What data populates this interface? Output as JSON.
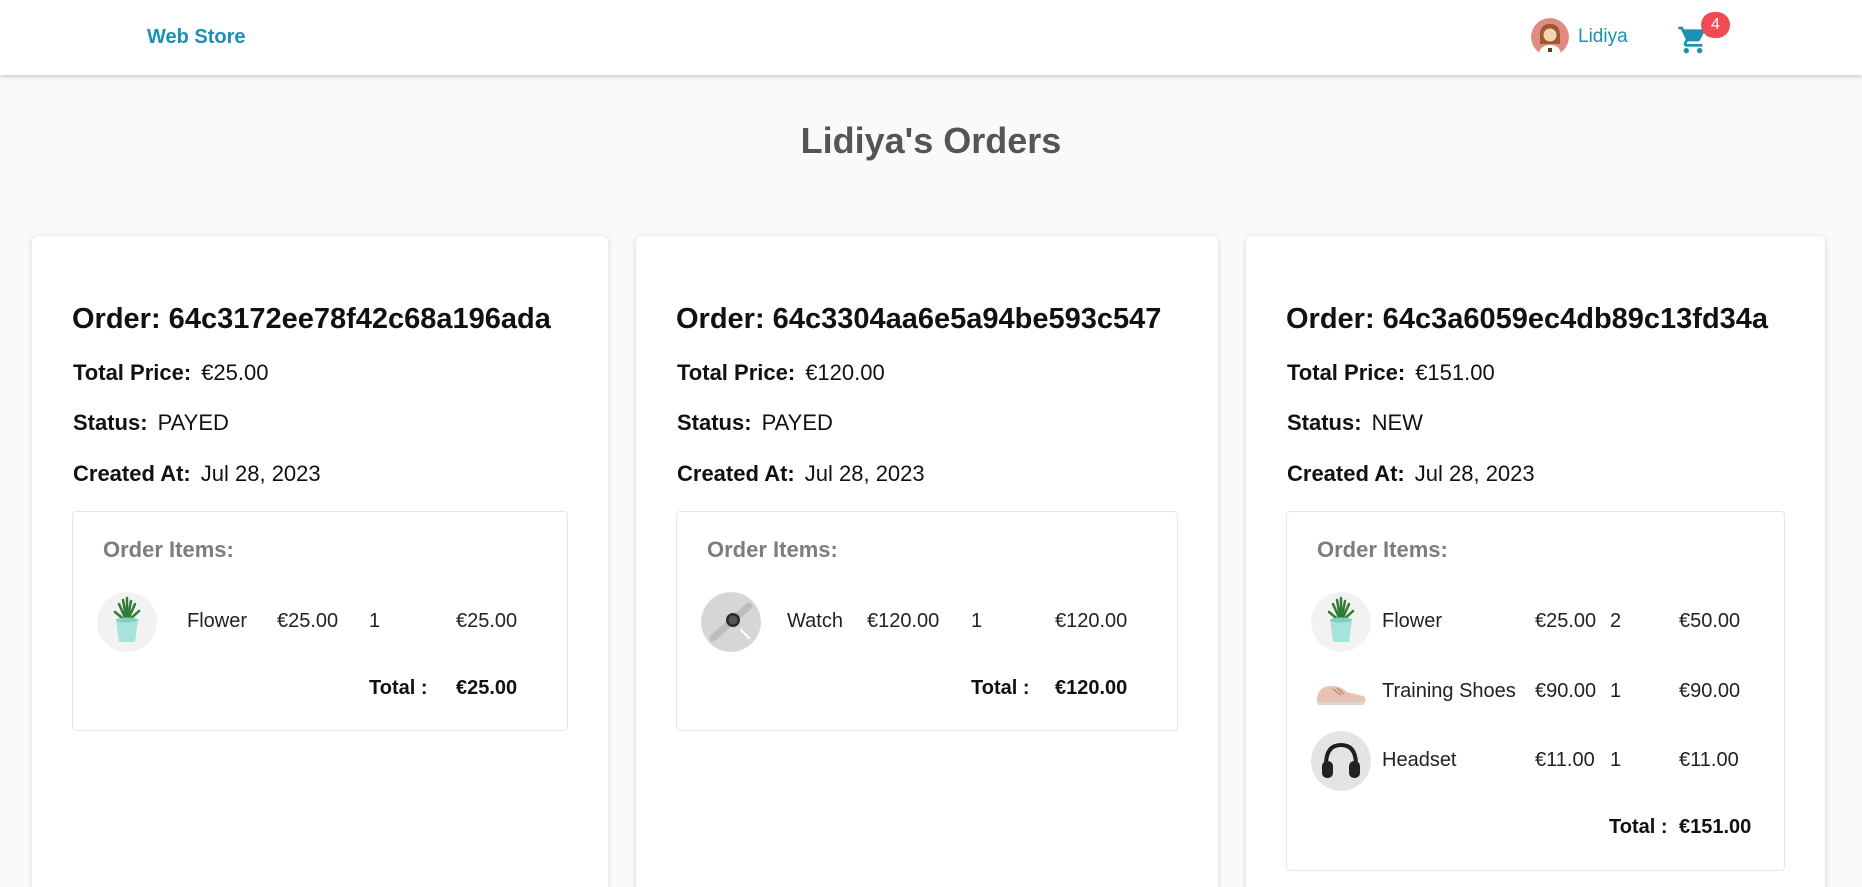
{
  "navbar": {
    "brand": "Web Store",
    "user_name": "Lidiya",
    "cart_count": "4"
  },
  "page": {
    "title": "Lidiya's Orders"
  },
  "labels": {
    "total_price": "Total Price:",
    "status": "Status:",
    "created_at": "Created At:",
    "order_items": "Order Items:",
    "total": "Total :"
  },
  "orders": [
    {
      "title": "Order: 64c3172ee78f42c68a196ada",
      "total_price": "€25.00",
      "status": "PAYED",
      "created_at": "Jul 28, 2023",
      "items": [
        {
          "name": "Flower",
          "price": "€25.00",
          "qty": "1",
          "subtotal": "€25.00",
          "icon": "plant-pot-icon"
        }
      ],
      "total": "€25.00"
    },
    {
      "title": "Order: 64c3304aa6e5a94be593c547",
      "total_price": "€120.00",
      "status": "PAYED",
      "created_at": "Jul 28, 2023",
      "items": [
        {
          "name": "Watch",
          "price": "€120.00",
          "qty": "1",
          "subtotal": "€120.00",
          "icon": "watch-icon"
        }
      ],
      "total": "€120.00"
    },
    {
      "title": "Order: 64c3a6059ec4db89c13fd34a",
      "total_price": "€151.00",
      "status": "NEW",
      "created_at": "Jul 28, 2023",
      "items": [
        {
          "name": "Flower",
          "price": "€25.00",
          "qty": "2",
          "subtotal": "€50.00",
          "icon": "plant-pot-icon"
        },
        {
          "name": "Training Shoes",
          "price": "€90.00",
          "qty": "1",
          "subtotal": "€90.00",
          "icon": "sneaker-icon"
        },
        {
          "name": "Headset",
          "price": "€11.00",
          "qty": "1",
          "subtotal": "€11.00",
          "icon": "headphones-icon"
        }
      ],
      "total": "€151.00"
    }
  ],
  "colors": {
    "brand": "#1b8fb4",
    "badge": "#ef4b52",
    "title": "#555555",
    "items_title": "#7d7d7d"
  }
}
